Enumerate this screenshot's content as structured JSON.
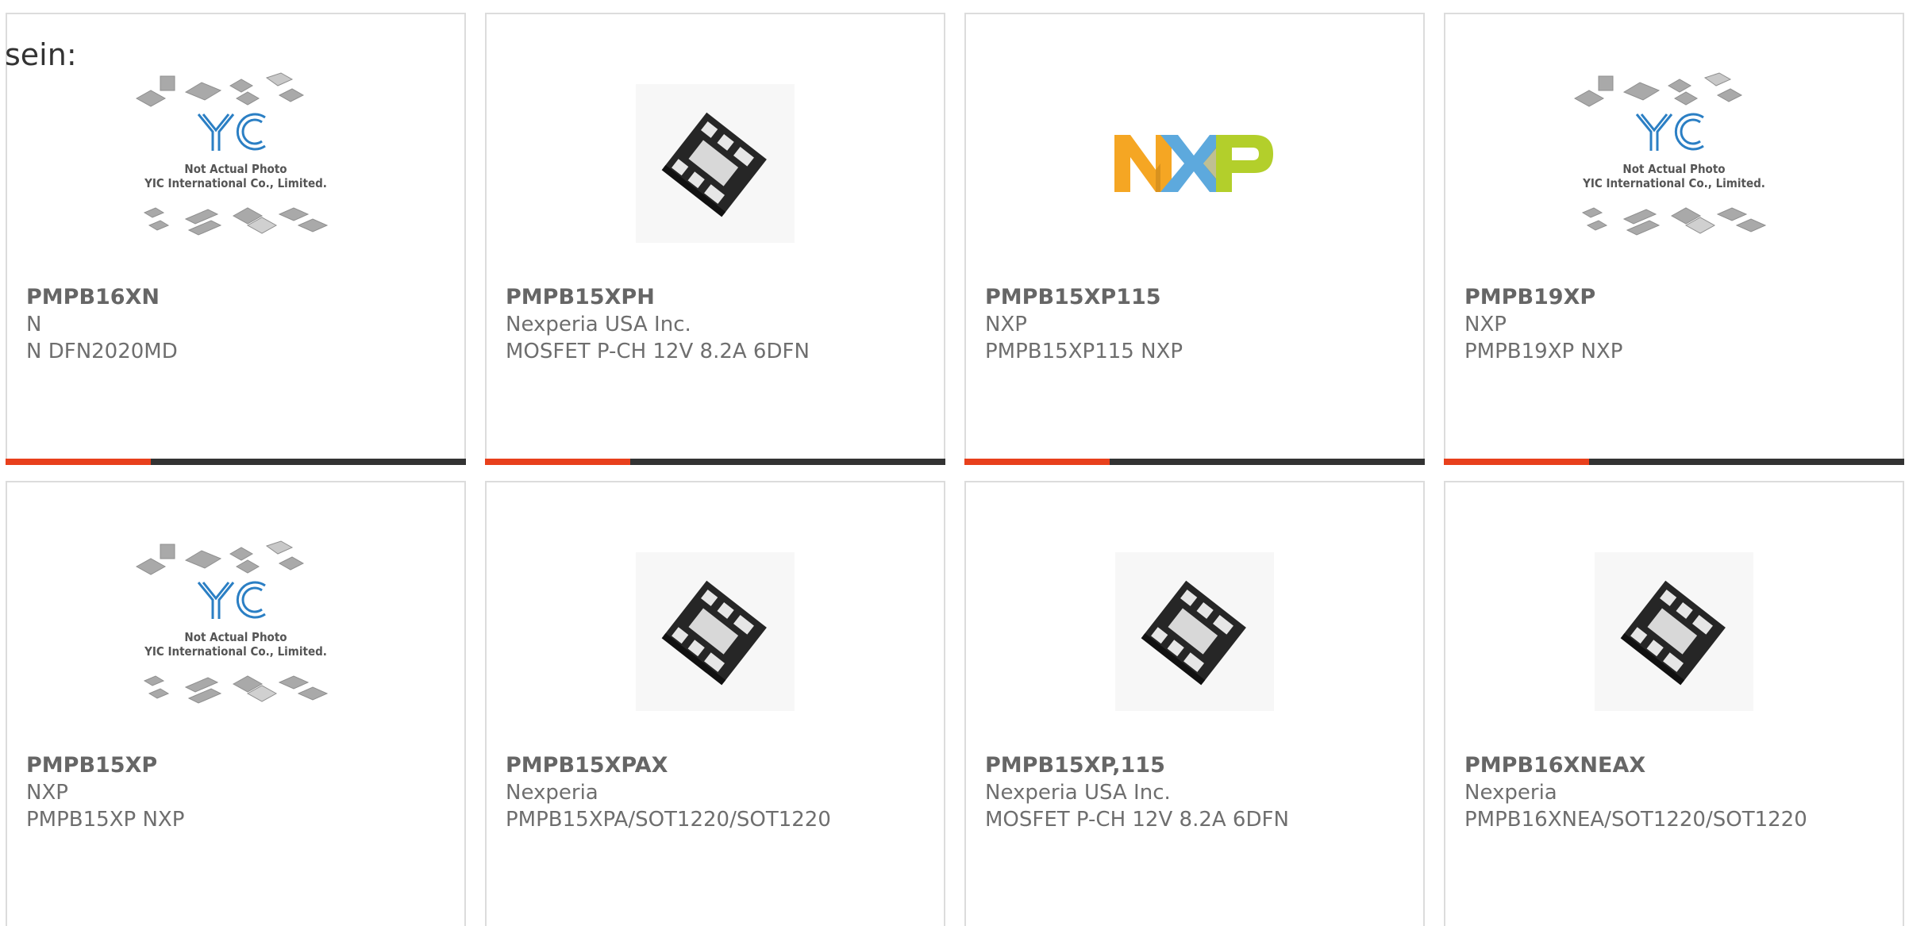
{
  "intro_text": "sein:",
  "colors": {
    "accent": "#e8401c",
    "bar": "#333333",
    "yic_blue": "#2b7fc4",
    "nxp_orange": "#f5a623",
    "nxp_blue": "#5da9dd",
    "nxp_green": "#b3cf2b"
  },
  "image_text": {
    "yic_line1": "Not Actual Photo",
    "yic_line2": "YIC International Co., Limited."
  },
  "products": [
    {
      "image": "yic-placeholder",
      "part": "PMPB16XN",
      "maker": "N",
      "desc": "N DFN2020MD"
    },
    {
      "image": "chip",
      "part": "PMPB15XPH",
      "maker": "Nexperia USA Inc.",
      "desc": "MOSFET P-CH 12V 8.2A 6DFN"
    },
    {
      "image": "nxp-logo",
      "part": "PMPB15XP115",
      "maker": "NXP",
      "desc": "PMPB15XP115 NXP"
    },
    {
      "image": "yic-placeholder",
      "part": "PMPB19XP",
      "maker": "NXP",
      "desc": "PMPB19XP NXP"
    },
    {
      "image": "yic-placeholder",
      "part": "PMPB15XP",
      "maker": "NXP",
      "desc": "PMPB15XP NXP"
    },
    {
      "image": "chip",
      "part": "PMPB15XPAX",
      "maker": "Nexperia",
      "desc": "PMPB15XPA/SOT1220/SOT1220"
    },
    {
      "image": "chip",
      "part": "PMPB15XP,115",
      "maker": "Nexperia USA Inc.",
      "desc": "MOSFET P-CH 12V 8.2A 6DFN"
    },
    {
      "image": "chip",
      "part": "PMPB16XNEAX",
      "maker": "Nexperia",
      "desc": "PMPB16XNEA/SOT1220/SOT1220"
    }
  ]
}
